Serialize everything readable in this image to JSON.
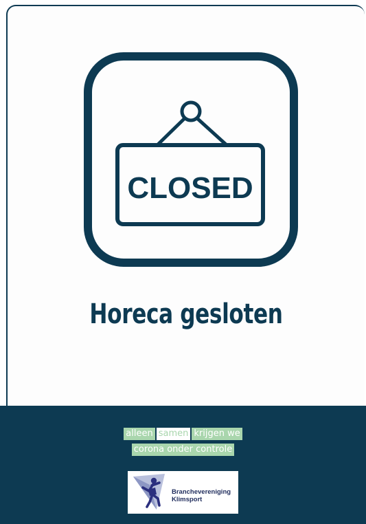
{
  "sign": {
    "sign_text": "CLOSED",
    "icon": "closed-sign-icon",
    "color": "#0d3a52"
  },
  "headline": "Horeca gesloten",
  "footer": {
    "background": "#0d3a52",
    "slogan_line1": [
      "alleen",
      "samen",
      "krijgen we"
    ],
    "slogan_line2": "corona onder controle",
    "accent": "#a9d6ad",
    "logo": {
      "line1": "Branchevereniging",
      "line2": "Klimsport",
      "icon": "climber-logo-icon"
    }
  }
}
